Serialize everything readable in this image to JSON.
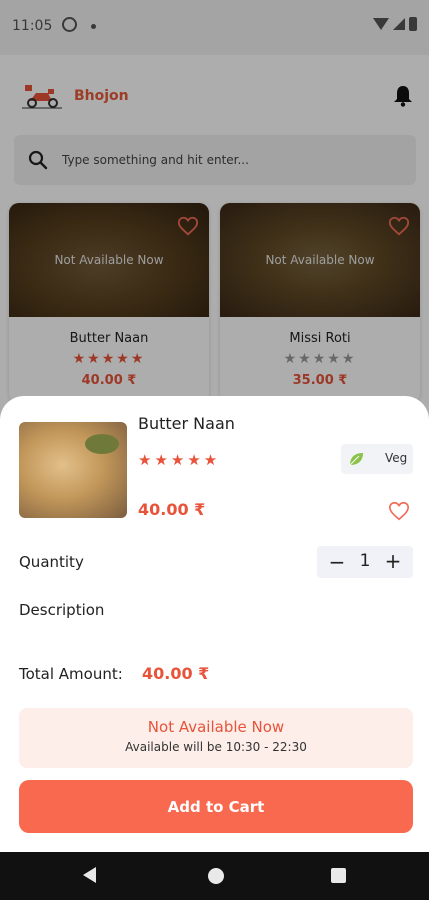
{
  "status_bar": {
    "time": "11:05"
  },
  "app": {
    "brand": "Bhojon"
  },
  "search": {
    "placeholder": "Type something and hit enter..."
  },
  "cards": [
    {
      "name": "Butter Naan",
      "price": "40.00 ₹",
      "availability": "Not Available Now",
      "rating": 5,
      "stars": "★★★★★"
    },
    {
      "name": "Missi Roti",
      "price": "35.00 ₹",
      "availability": "Not Available Now",
      "rating": 0,
      "stars": "★★★★★"
    }
  ],
  "sheet": {
    "name": "Butter Naan",
    "rating": 5,
    "stars": "★★★★★",
    "price": "40.00 ₹",
    "veg_label": "Veg",
    "quantity_label": "Quantity",
    "quantity_minus": "−",
    "quantity_value": "1",
    "quantity_plus": "+",
    "description_label": "Description",
    "total_label": "Total Amount:",
    "total_value": "40.00 ₹",
    "availability_title": "Not Available Now",
    "availability_hours": "Available will be 10:30 - 22:30",
    "add_to_cart_label": "Add to Cart"
  },
  "colors": {
    "accent": "#e8533a",
    "button": "#f9694f",
    "availability_bg": "#fdeee9",
    "star_inactive": "#9a9a9a"
  },
  "icons": [
    "search-icon",
    "bell-icon",
    "heart-icon",
    "leaf-icon",
    "back-icon",
    "home-icon",
    "recent-apps-icon"
  ]
}
